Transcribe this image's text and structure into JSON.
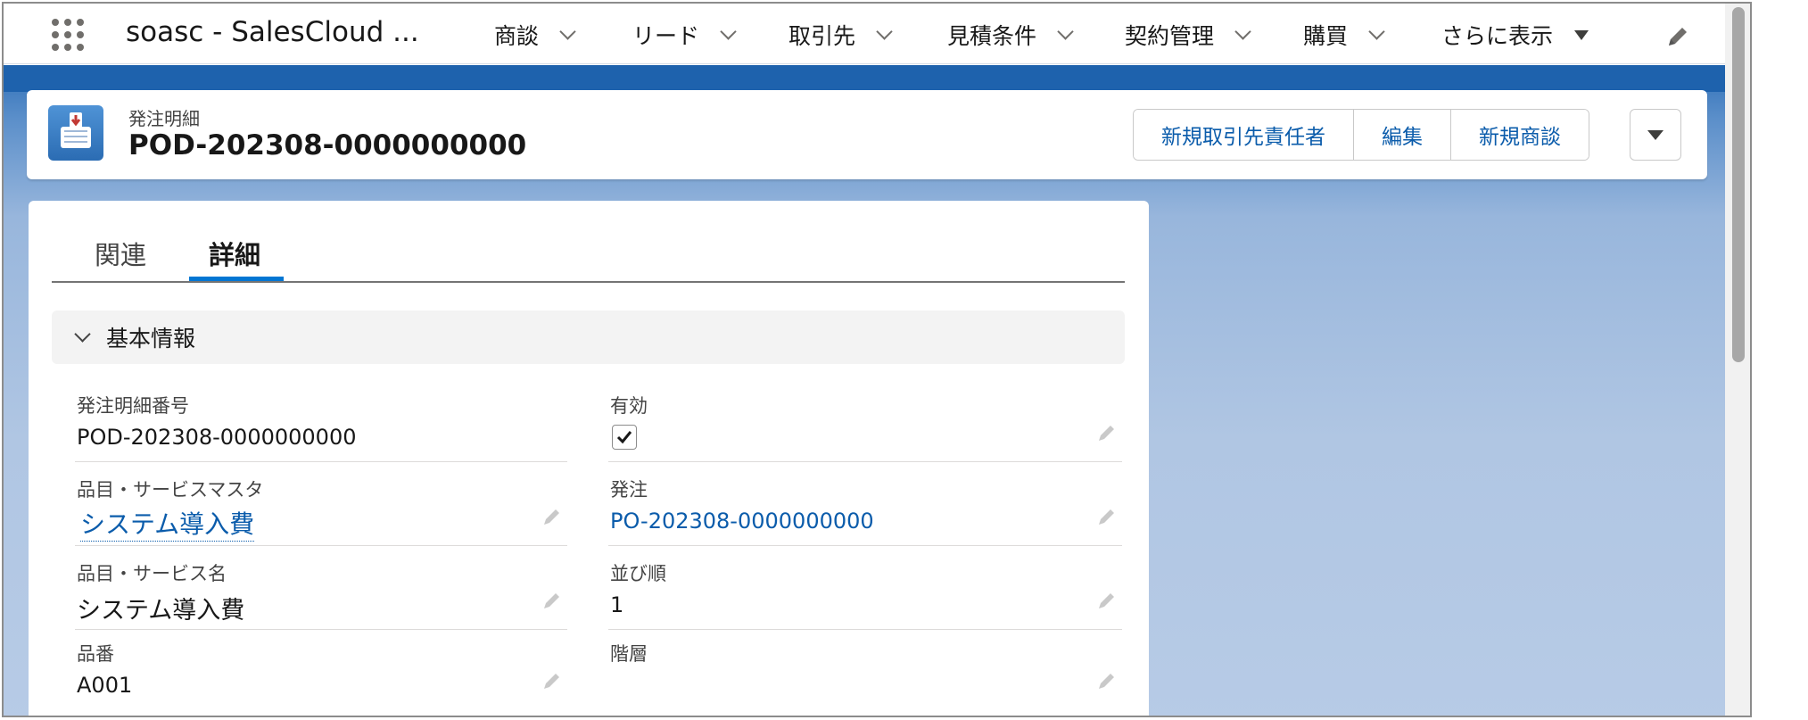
{
  "nav": {
    "app_name": "soasc - SalesCloud ...",
    "items": [
      {
        "label": "商談"
      },
      {
        "label": "リード"
      },
      {
        "label": "取引先"
      },
      {
        "label": "見積条件"
      },
      {
        "label": "契約管理"
      },
      {
        "label": "購買"
      }
    ],
    "more_label": "さらに表示"
  },
  "header": {
    "object_label": "発注明細",
    "record_title": "POD-202308-0000000000",
    "actions": [
      {
        "label": "新規取引先責任者"
      },
      {
        "label": "編集"
      },
      {
        "label": "新規商談"
      }
    ]
  },
  "tabs": [
    {
      "label": "関連",
      "active": false
    },
    {
      "label": "詳細",
      "active": true
    }
  ],
  "section": {
    "title": "基本情報",
    "fields_left": [
      {
        "label": "発注明細番号",
        "value": "POD-202308-0000000000",
        "type": "text",
        "editable": false
      },
      {
        "label": "品目・サービスマスタ",
        "value": "システム導入費",
        "type": "link",
        "editable": true
      },
      {
        "label": "品目・サービス名",
        "value": "システム導入費",
        "type": "text",
        "editable": true
      },
      {
        "label": "品番",
        "value": "A001",
        "type": "text",
        "editable": true
      }
    ],
    "fields_right": [
      {
        "label": "有効",
        "checked": true,
        "type": "checkbox",
        "editable": true
      },
      {
        "label": "発注",
        "value": "PO-202308-0000000000",
        "type": "link",
        "editable": true
      },
      {
        "label": "並び順",
        "value": "1",
        "type": "text",
        "editable": true
      },
      {
        "label": "階層",
        "value": "",
        "type": "text",
        "editable": true
      }
    ]
  },
  "colors": {
    "brand_blue": "#0176d3",
    "link_blue": "#0b5cab",
    "header_band": "#1e62ad"
  }
}
